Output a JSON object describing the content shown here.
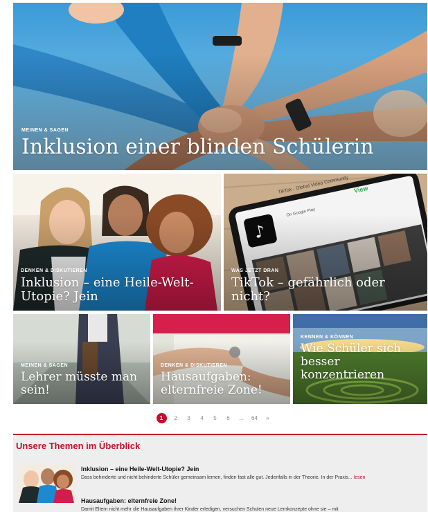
{
  "hero": {
    "category": "MEINEN & SAGEN",
    "headline": "Inklusion einer blinden Schülerin"
  },
  "tiles": [
    {
      "category": "DENKEN & DISKUTIEREN",
      "headline": "Inklusion – eine Heile-Welt-Utopie? Jein"
    },
    {
      "category": "WAS JETZT DRAN",
      "headline": "TikTok – gefährlich oder nicht?"
    },
    {
      "category": "MEINEN & SAGEN",
      "headline": "Lehrer müsste man sein!"
    },
    {
      "category": "DENKEN & DISKUTIEREN",
      "headline": "Hausaufgaben: elternfreie Zone!"
    },
    {
      "category": "KENNEN & KÖNNEN",
      "headline": "Wie Schüler sich besser konzentrieren"
    }
  ],
  "tiktok_card": {
    "app_name": "TikTok - Global Video Community",
    "view_label": "View",
    "store_label": "On Google Play"
  },
  "pagination": {
    "pages": [
      "1",
      "2",
      "3",
      "4",
      "5",
      "6",
      "...",
      "64",
      "»"
    ],
    "active": "1"
  },
  "themes": {
    "title": "Unsere Themen im Überblick",
    "items": [
      {
        "title": "Inklusion – eine Heile-Welt-Utopie? Jein",
        "text": "Dass behinderte und nicht behinderte Schüler gemeinsam lernen, finden fast alle gut. Jedenfalls in der Theorie. In der Praxis...",
        "link": "lesen"
      },
      {
        "title": "Hausaufgaben: elternfreie Zone!",
        "text": "Damit Eltern nicht mehr die Hausaufgaben ihrer Kinder erledigen, versuchen Schulen neue Lernkonzepte ohne sie – mit"
      }
    ]
  },
  "colors": {
    "accent": "#c0122c",
    "panel": "#eeeeee",
    "sky": "#4aa3dd"
  }
}
